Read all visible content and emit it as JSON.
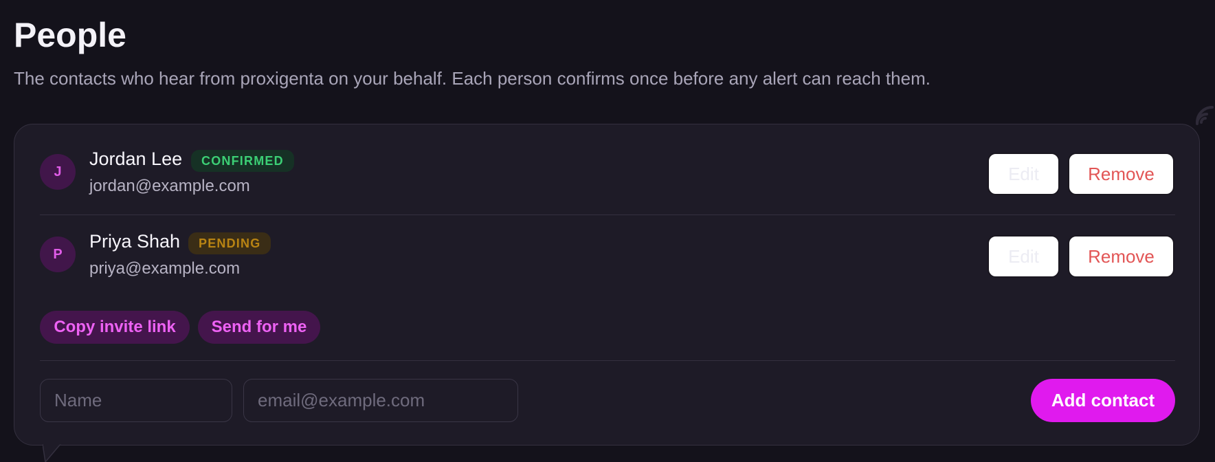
{
  "header": {
    "title": "People",
    "subtitle": "The contacts who hear from proxigenta on your behalf. Each person confirms once before any alert can reach them."
  },
  "contacts": [
    {
      "initial": "J",
      "name": "Jordan Lee",
      "status": "CONFIRMED",
      "email": "jordan@example.com",
      "edit_label": "Edit",
      "remove_label": "Remove"
    },
    {
      "initial": "P",
      "name": "Priya Shah",
      "status": "PENDING",
      "email": "priya@example.com",
      "edit_label": "Edit",
      "remove_label": "Remove"
    }
  ],
  "invite": {
    "copy_label": "Copy invite link",
    "send_label": "Send for me"
  },
  "add_form": {
    "name_placeholder": "Name",
    "email_placeholder": "email@example.com",
    "submit_label": "Add contact"
  },
  "colors": {
    "background": "#14121b",
    "card": "#1e1b27",
    "accent": "#e01aee",
    "confirmed": "#3ccf75",
    "pending": "#b98413",
    "danger": "#e25555"
  },
  "icons": {
    "top_right": "wifi-icon"
  }
}
